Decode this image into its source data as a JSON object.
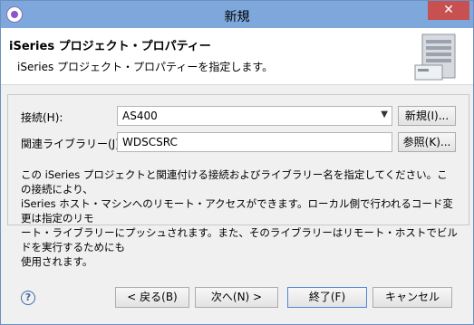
{
  "window": {
    "title": "新規",
    "close_symbol": "✕"
  },
  "header": {
    "title": "iSeries プロジェクト・プロパティー",
    "description": "iSeries プロジェクト・プロパティーを指定します。"
  },
  "form": {
    "connection": {
      "label": "接続(H):",
      "value": "AS400",
      "button": "新規(I)..."
    },
    "library": {
      "label": "関連ライブラリー(J):",
      "value": "WDSCSRC",
      "button": "参照(K)..."
    },
    "description_lines": [
      "この iSeries プロジェクトと関連付ける接続およびライブラリー名を指定してください。この接続により、",
      "iSeries ホスト・マシンへのリモート・アクセスができます。ローカル側で行われるコード変更は指定のリモ",
      "ート・ライブラリーにプッシュされます。また、そのライブラリーはリモート・ホストでビルドを実行するためにも",
      "使用されます。"
    ]
  },
  "footer": {
    "back": "< 戻る(B)",
    "next": "次へ(N) >",
    "finish": "終了(F)",
    "cancel": "キャンセル",
    "help": "?"
  }
}
